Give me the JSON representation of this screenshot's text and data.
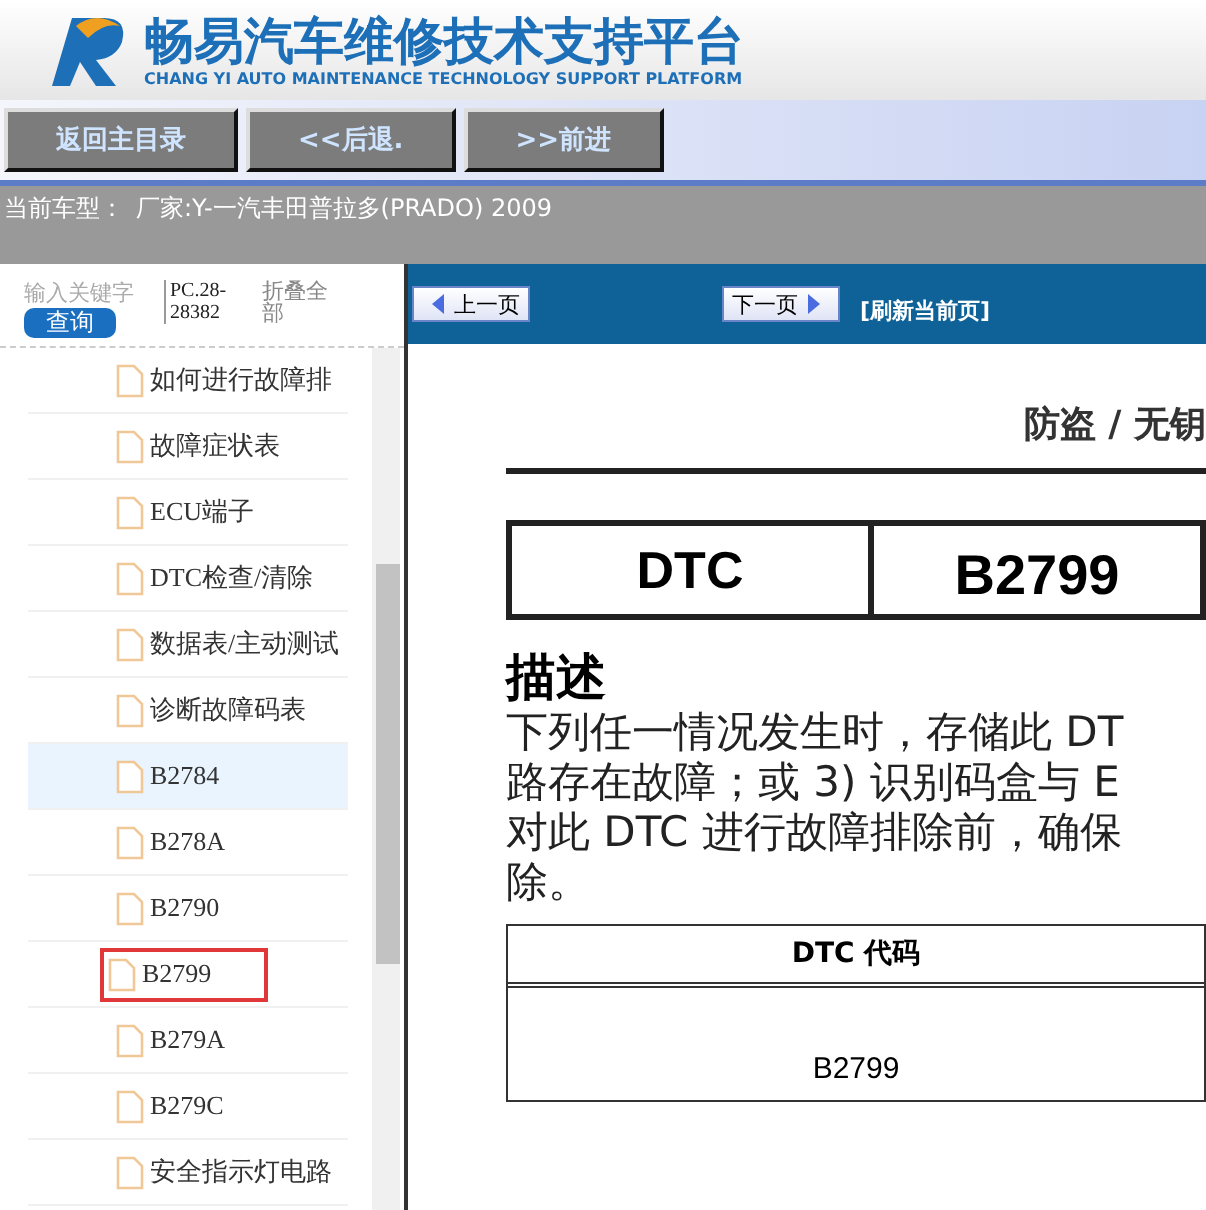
{
  "header": {
    "title": "畅易汽车维修技术支持平台",
    "subtitle": "CHANG YI AUTO MAINTENANCE TECHNOLOGY SUPPORT PLATFORM"
  },
  "nav_buttons": [
    "返回主目录",
    "<<后退.",
    ">>前进"
  ],
  "vehicle_bar": {
    "label": "当前车型：",
    "value": "厂家:Y-一汽丰田普拉多(PRADO) 2009"
  },
  "sidebar": {
    "search": {
      "placeholder": "输入关键字"
    },
    "search_button": "查询",
    "code": "PC.28-28382",
    "collapse_link": "折叠全部",
    "items": [
      {
        "label": "如何进行故障排",
        "selected": false,
        "marked": false
      },
      {
        "label": "故障症状表",
        "selected": false,
        "marked": false
      },
      {
        "label": "ECU端子",
        "selected": false,
        "marked": false
      },
      {
        "label": "DTC检查/清除",
        "selected": false,
        "marked": false
      },
      {
        "label": "数据表/主动测试",
        "selected": false,
        "marked": false
      },
      {
        "label": "诊断故障码表",
        "selected": false,
        "marked": false
      },
      {
        "label": "B2784",
        "selected": true,
        "marked": false
      },
      {
        "label": "B278A",
        "selected": false,
        "marked": false
      },
      {
        "label": "B2790",
        "selected": false,
        "marked": false
      },
      {
        "label": "B2799",
        "selected": false,
        "marked": true
      },
      {
        "label": "B279A",
        "selected": false,
        "marked": false
      },
      {
        "label": "B279C",
        "selected": false,
        "marked": false
      },
      {
        "label": "安全指示灯电路",
        "selected": false,
        "marked": false
      }
    ]
  },
  "page_nav": {
    "prev": "上一页",
    "next": "下一页",
    "refresh": "[刷新当前页]"
  },
  "document": {
    "section_title": "防盗 / 无钥",
    "dtc_label": "DTC",
    "dtc_code": "B2799",
    "heading": "描述",
    "paragraph_lines": [
      "下列任一情况发生时，存储此 DT",
      "路存在故障；或 3) 识别码盒与 E",
      "对此 DTC 进行故障排除前，确保",
      "除。"
    ],
    "table": {
      "header": "DTC 代码",
      "cell": "B2799"
    }
  }
}
